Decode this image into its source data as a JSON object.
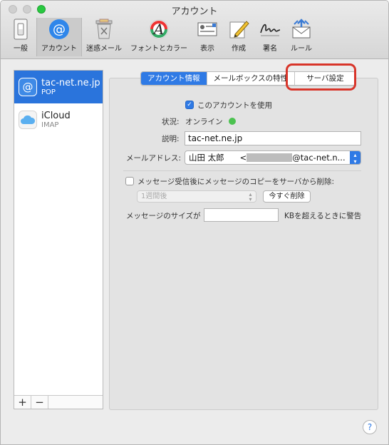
{
  "window": {
    "title": "アカウント"
  },
  "toolbar": [
    {
      "label": "一般",
      "icon": "light-switch-icon"
    },
    {
      "label": "アカウント",
      "icon": "at-sign-icon",
      "active": true
    },
    {
      "label": "迷惑メール",
      "icon": "junk-trash-icon"
    },
    {
      "label": "フォントとカラー",
      "icon": "font-color-icon"
    },
    {
      "label": "表示",
      "icon": "view-envelope-icon"
    },
    {
      "label": "作成",
      "icon": "compose-pencil-icon"
    },
    {
      "label": "署名",
      "icon": "signature-icon"
    },
    {
      "label": "ルール",
      "icon": "rules-envelope-icon"
    }
  ],
  "sidebar": {
    "accounts": [
      {
        "name": "tac-net.ne.jp",
        "type": "POP",
        "icon": "at-sign-icon",
        "selected": true
      },
      {
        "name": "iCloud",
        "type": "IMAP",
        "icon": "cloud-icon",
        "selected": false
      }
    ],
    "add_label": "+",
    "remove_label": "−"
  },
  "tabs": [
    {
      "label": "アカウント情報",
      "selected": true
    },
    {
      "label": "メールボックスの特性",
      "selected": false
    },
    {
      "label": "サーバ設定",
      "selected": false
    }
  ],
  "form": {
    "use_account_label": "このアカウントを使用",
    "use_account_checked": true,
    "status_label": "状況:",
    "status_value": "オンライン",
    "description_label": "説明:",
    "description_value": "tac-net.ne.jp",
    "email_label": "メールアドレス:",
    "email_name": "山田 太郎",
    "email_open": "<",
    "email_domain": "@tac-net.n...",
    "remove_copy_label": "メッセージ受信後にメッセージのコピーをサーバから削除:",
    "remove_copy_checked": false,
    "remove_period_value": "1週間後",
    "remove_now_label": "今すぐ削除",
    "size_label": "メッセージのサイズが",
    "size_value": "",
    "size_suffix": "KBを超えるときに警告"
  },
  "help_label": "?",
  "colors": {
    "accent": "#2f7ae5",
    "selection": "#2a74dc",
    "online": "#4cc250",
    "highlight_ring": "#d8352a"
  }
}
